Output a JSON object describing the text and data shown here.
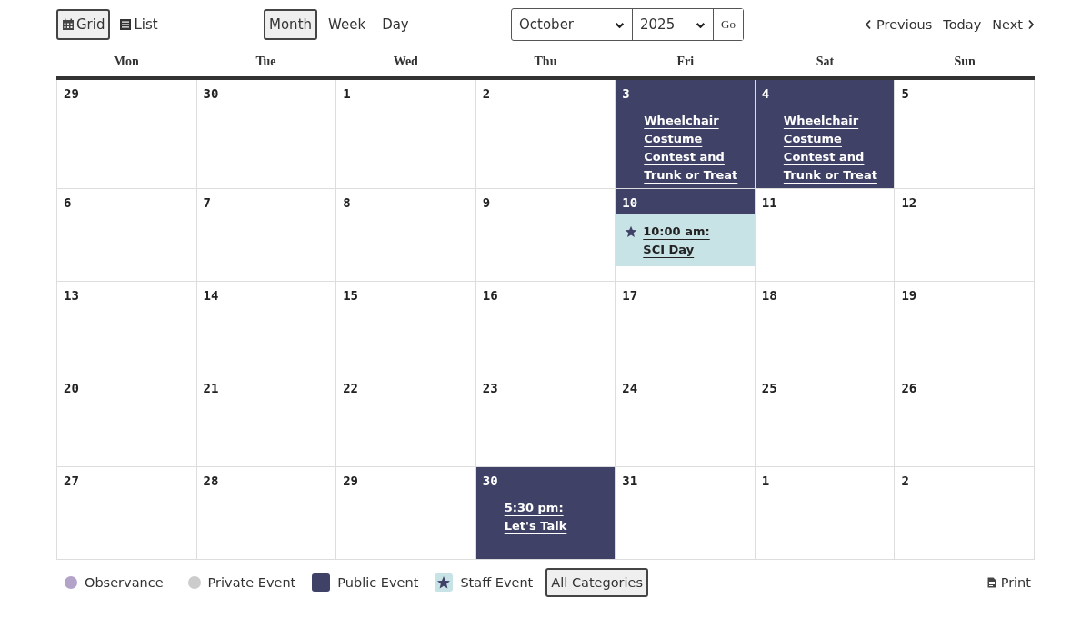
{
  "view_toggle": [
    {
      "label": "Grid",
      "kind": "grid",
      "selected": true
    },
    {
      "label": "List",
      "kind": "list",
      "selected": false
    }
  ],
  "range_tabs": [
    {
      "label": "Month",
      "selected": true
    },
    {
      "label": "Week",
      "selected": false
    },
    {
      "label": "Day",
      "selected": false
    }
  ],
  "jump": {
    "month": "October",
    "year": "2025",
    "go": "Go"
  },
  "nav": {
    "previous": "Previous",
    "today": "Today",
    "next": "Next"
  },
  "weekdays": [
    "Mon",
    "Tue",
    "Wed",
    "Thu",
    "Fri",
    "Sat",
    "Sun"
  ],
  "weeks": [
    [
      {
        "day": "29"
      },
      {
        "day": "30"
      },
      {
        "day": "1"
      },
      {
        "day": "2"
      },
      {
        "day": "3",
        "events": [
          {
            "kind": "public",
            "title": "Wheelchair Costume Contest and Trunk or Treat"
          }
        ]
      },
      {
        "day": "4",
        "events": [
          {
            "kind": "public",
            "title": "Wheelchair Costume Contest and Trunk or Treat"
          }
        ]
      },
      {
        "day": "5"
      }
    ],
    [
      {
        "day": "6"
      },
      {
        "day": "7"
      },
      {
        "day": "8"
      },
      {
        "day": "9"
      },
      {
        "day": "10",
        "events": [
          {
            "kind": "staff",
            "time": "10:00 am:",
            "title": "SCI Day"
          }
        ]
      },
      {
        "day": "11"
      },
      {
        "day": "12"
      }
    ],
    [
      {
        "day": "13"
      },
      {
        "day": "14"
      },
      {
        "day": "15"
      },
      {
        "day": "16"
      },
      {
        "day": "17"
      },
      {
        "day": "18"
      },
      {
        "day": "19"
      }
    ],
    [
      {
        "day": "20"
      },
      {
        "day": "21"
      },
      {
        "day": "22"
      },
      {
        "day": "23"
      },
      {
        "day": "24"
      },
      {
        "day": "25"
      },
      {
        "day": "26"
      }
    ],
    [
      {
        "day": "27"
      },
      {
        "day": "28"
      },
      {
        "day": "29"
      },
      {
        "day": "30",
        "events": [
          {
            "kind": "public",
            "time": "5:30 pm:",
            "title": "Let's Talk"
          }
        ]
      },
      {
        "day": "31"
      },
      {
        "day": "1"
      },
      {
        "day": "2"
      }
    ]
  ],
  "legend": [
    {
      "kind": "dot",
      "label": "Observance",
      "color": "#b3a3c9"
    },
    {
      "kind": "dot",
      "label": "Private Event",
      "color": "#cccccc"
    },
    {
      "kind": "square",
      "label": "Public Event",
      "color": "#3f4266"
    },
    {
      "kind": "star",
      "label": "Staff Event",
      "color": "#c8e3e6"
    }
  ],
  "all_categories": "All Categories",
  "print": "Print"
}
